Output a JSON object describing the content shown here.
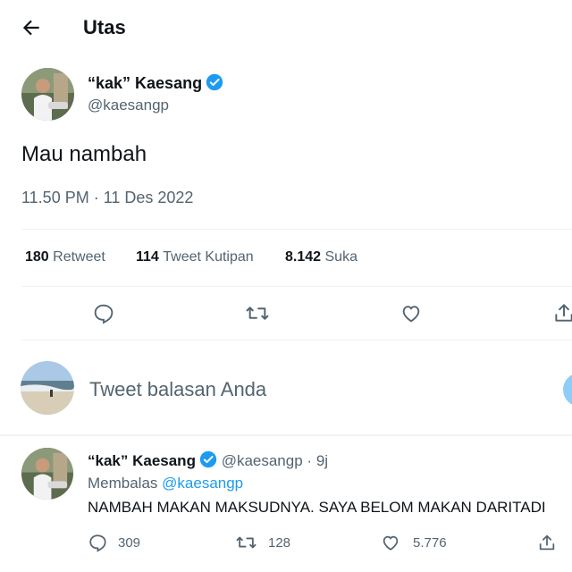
{
  "header": {
    "title": "Utas"
  },
  "tweet": {
    "name": "“kak” Kaesang",
    "handle": "@kaesangp",
    "text": "Mau nambah",
    "timestamp": "11.50 PM · 11 Des 2022",
    "stats": {
      "retweets_count": "180",
      "retweets_label": "Retweet",
      "quotes_count": "114",
      "quotes_label": "Tweet Kutipan",
      "likes_count": "8.142",
      "likes_label": "Suka"
    }
  },
  "composer": {
    "placeholder": "Tweet balasan Anda"
  },
  "reply": {
    "name": "“kak” Kaesang",
    "handle": "@kaesangp",
    "separator": "·",
    "time": "9j",
    "replying_label": "Membalas",
    "replying_to": "@kaesangp",
    "text": "NAMBAH MAKAN MAKSUDNYA. SAYA BELOM MAKAN DARITADI",
    "replies": "309",
    "retweets": "128",
    "likes": "5.776"
  },
  "colors": {
    "accent": "#1d9bf0",
    "muted": "#536471",
    "text": "#0f1419",
    "divider": "#eff3f4"
  },
  "icons": [
    "back-arrow-icon",
    "verified-badge-icon",
    "reply-icon",
    "retweet-icon",
    "like-icon",
    "share-icon"
  ]
}
